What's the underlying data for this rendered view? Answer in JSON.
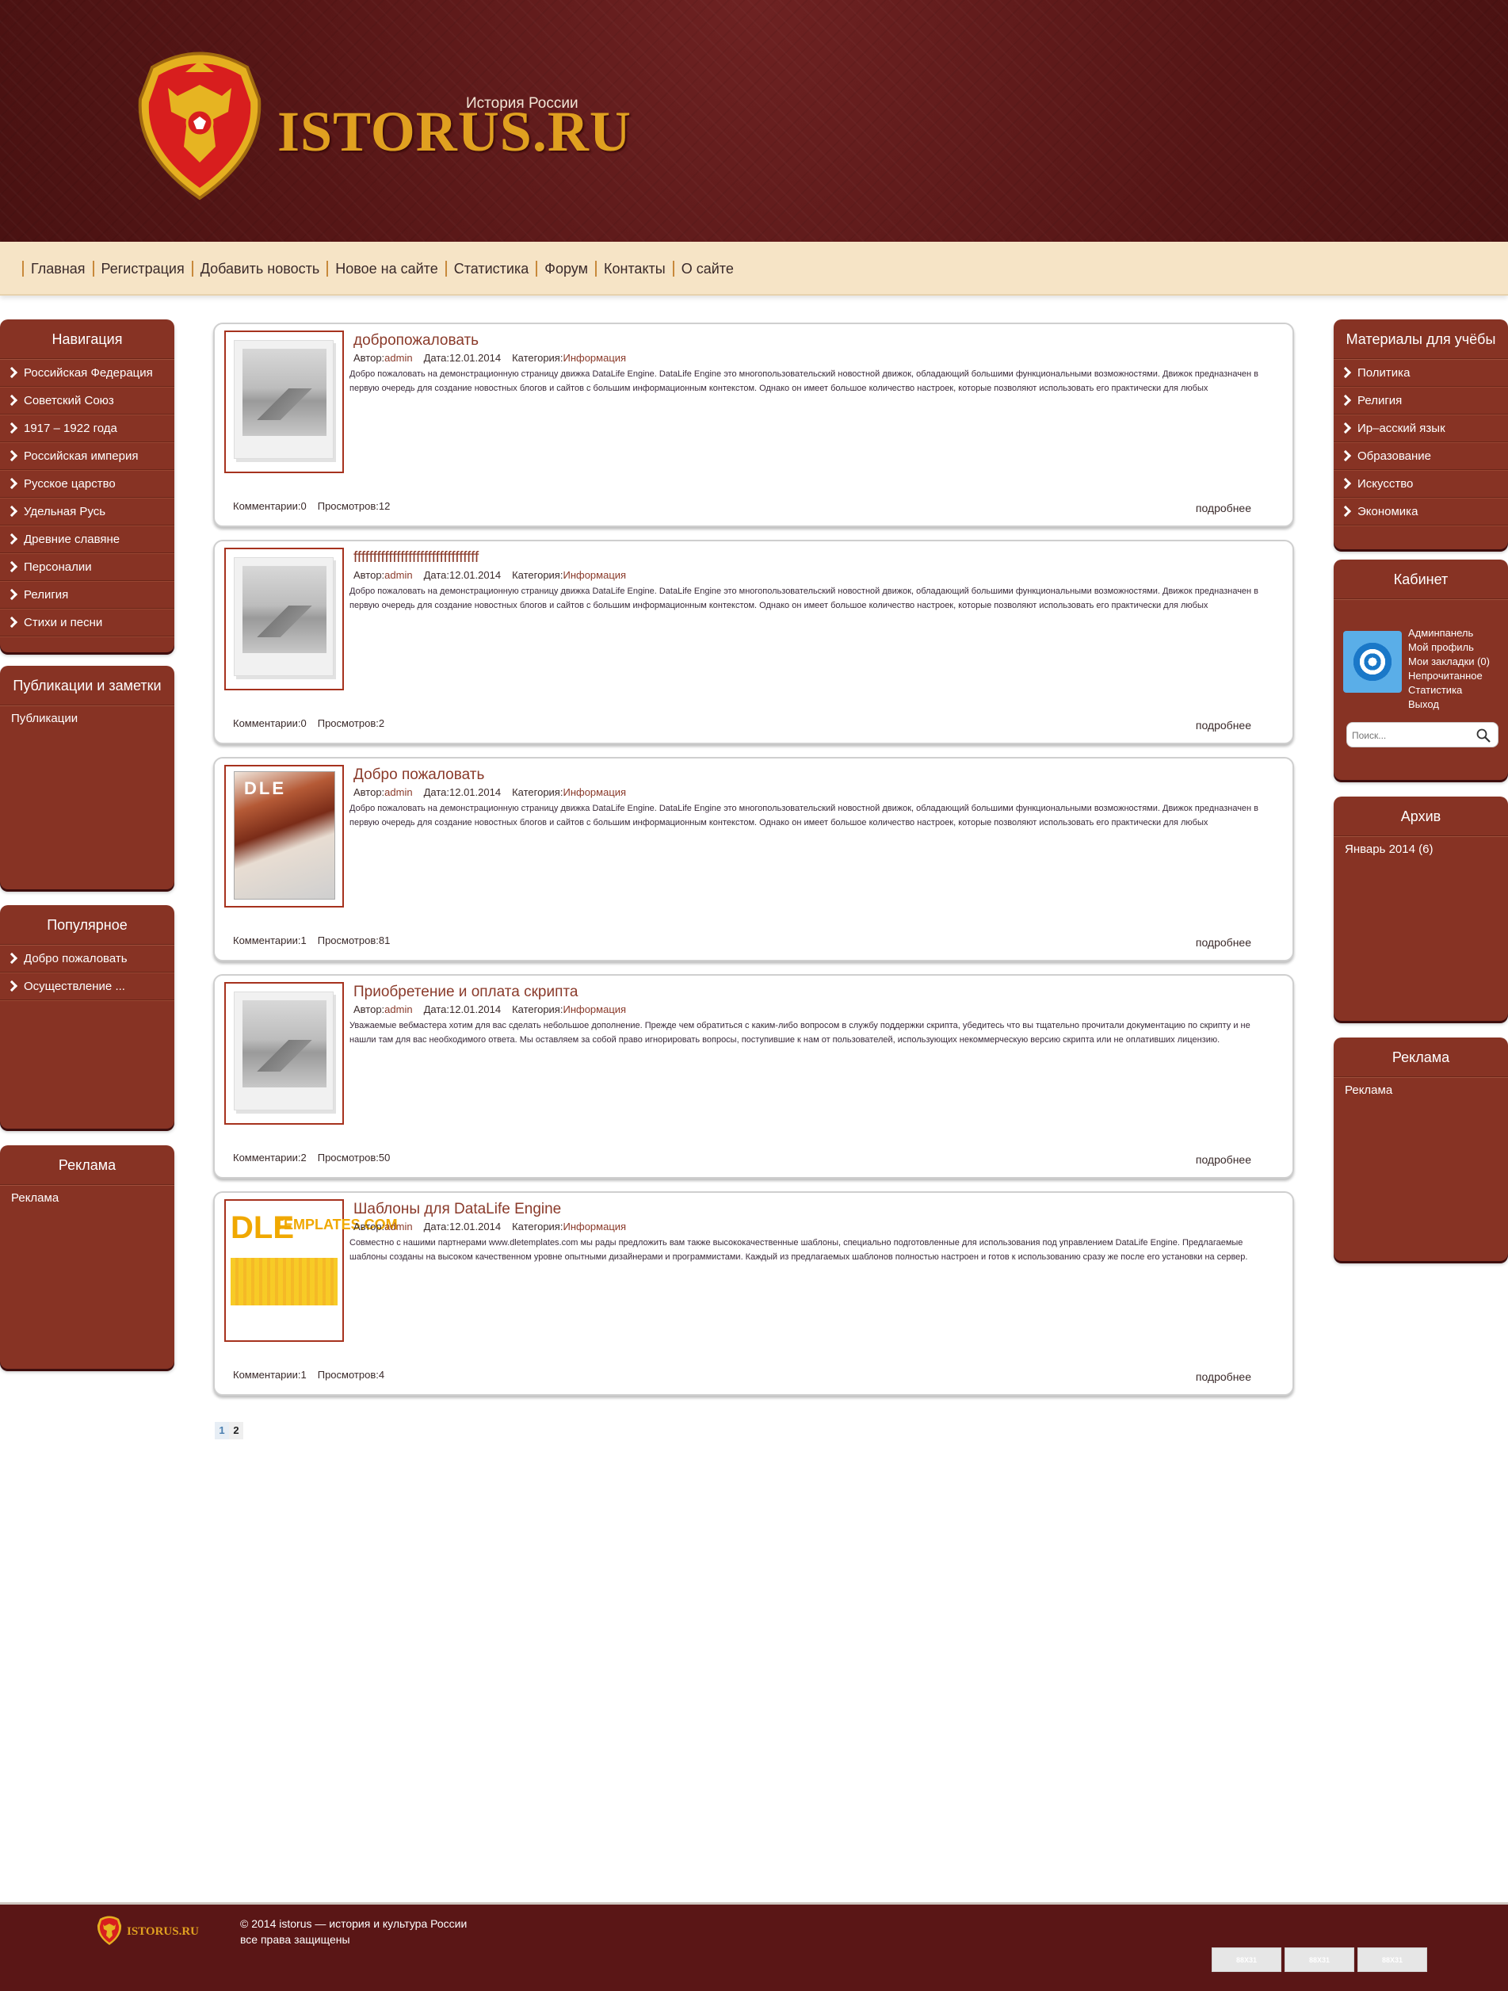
{
  "header": {
    "logo_text": "ISTORUS.RU",
    "logo_subtitle": "История России"
  },
  "nav": [
    "Главная",
    "Регистрация",
    "Добавить новость",
    "Новое на сайте",
    "Статистика",
    "Форум",
    "Контакты",
    "О сайте"
  ],
  "left": {
    "navigation": {
      "title": "Навигация",
      "items": [
        "Российская Федерация",
        "Советский Союз",
        "1917 – 1922 года",
        "Российская империя",
        "Русское царство",
        "Удельная Русь",
        "Древние славяне",
        "Персоналии",
        "Религия",
        "Стихи и песни"
      ]
    },
    "publications": {
      "title": "Публикации и заметки",
      "items": [
        "Публикации"
      ]
    },
    "popular": {
      "title": "Популярное",
      "items": [
        "Добро пожаловать",
        "Осуществление ..."
      ]
    },
    "ads": {
      "title": "Реклама",
      "text": "Реклама"
    }
  },
  "labels": {
    "author": "Автор:",
    "date": "Дата:",
    "category": "Категория:",
    "comments": "Комментарии:",
    "views": "Просмотров:",
    "more": "подробнее"
  },
  "posts": [
    {
      "title": "добропожаловать",
      "author": "admin",
      "date": "12.01.2014",
      "category": "Информация",
      "excerpt": "Добро пожаловать на демонстрационную страницу движка DataLife Engine. DataLife Engine это многопользовательский новостной движок, обладающий большими функциональными возможностями. Движок предназначен в первую очередь для создание новостных блогов и сайтов с большим информационным контекстом. Однако он имеет большое количество настроек, которые позволяют использовать его практически для любых",
      "comments": "0",
      "views": "12"
    },
    {
      "title": "ffffffffffffffffffffffffffffffff",
      "author": "admin",
      "date": "12.01.2014",
      "category": "Информация",
      "excerpt": "Добро пожаловать на демонстрационную страницу движка DataLife Engine. DataLife Engine это многопользовательский новостной движок, обладающий большими функциональными возможностями. Движок предназначен в первую очередь для создание новостных блогов и сайтов с большим информационным контекстом. Однако он имеет большое количество настроек, которые позволяют использовать его практически для любых",
      "comments": "0",
      "views": "2"
    },
    {
      "title": "Добро пожаловать",
      "author": "admin",
      "date": "12.01.2014",
      "category": "Информация",
      "excerpt": "Добро пожаловать на демонстрационную страницу движка DataLife Engine. DataLife Engine это многопользовательский новостной движок, обладающий большими функциональными возможностями. Движок предназначен в первую очередь для создание новостных блогов и сайтов с большим информационным контекстом. Однако он имеет большое количество настроек, которые позволяют использовать его практически для любых",
      "comments": "1",
      "views": "81",
      "thumb_text": "DLE"
    },
    {
      "title": "Приобретение и оплата скрипта",
      "author": "admin",
      "date": "12.01.2014",
      "category": "Информация",
      "excerpt": "Уважаемые вебмастера хотим для вас сделать небольшое дополнение. Прежде чем обратиться с каким-либо вопросом в службу поддержки скрипта, убедитесь что вы тщательно прочитали документацию по скрипту и не нашли там для вас необходимого ответа. Мы оставляем за собой право игнорировать вопросы, поступившие к нам от пользователей, использующих некоммерческую версию скрипта или не оплативших лицензию.",
      "comments": "2",
      "views": "50"
    },
    {
      "title": "Шаблоны для DataLife Engine",
      "author": "admin",
      "date": "12.01.2014",
      "category": "Информация",
      "excerpt": "Совместно с нашими партнерами www.dletemplates.com мы рады предложить вам также высококачественные шаблоны, специально подготовленные для использования под управлением DataLife Engine. Предлагаемые шаблоны созданы на высоком качественном уровне опытными дизайнерами и программистами. Каждый из предлагаемых шаблонов полностью настроен и готов к использованию сразу же после его установки на сервер.",
      "comments": "1",
      "views": "4",
      "thumb_text_a": "DLE",
      "thumb_text_b": "TEMPLATES.COM"
    }
  ],
  "pagination": {
    "current": "1",
    "next": "2"
  },
  "right": {
    "materials": {
      "title": "Материалы для учёбы",
      "items": [
        "Политика",
        "Религия",
        "Ир–асский язык",
        "Образование",
        "Искусство",
        "Экономика"
      ]
    },
    "cabinet": {
      "title": "Кабинет",
      "links": [
        "Админпанель",
        "Мой профиль",
        "Мои закладки (0)",
        "Непрочитанное",
        "Статистика",
        "Выход"
      ],
      "search_placeholder": "Поиск..."
    },
    "archive": {
      "title": "Архив",
      "items": [
        "Январь 2014 (6)"
      ]
    },
    "ads": {
      "title": "Реклама",
      "text": "Реклама"
    }
  },
  "footer": {
    "logo_text": "ISTORUS.RU",
    "copyright": "© 2014 istorus — история и культура России",
    "rights": "все права защищены",
    "counters": [
      "88X31",
      "88X31",
      "88X31"
    ]
  },
  "colors": {
    "header_bg": "#5e1a1a",
    "nav_bg": "#f6e4c6",
    "block_bg": "#873324",
    "link": "#8a3a2a",
    "logo_gold": "#e0a020"
  }
}
